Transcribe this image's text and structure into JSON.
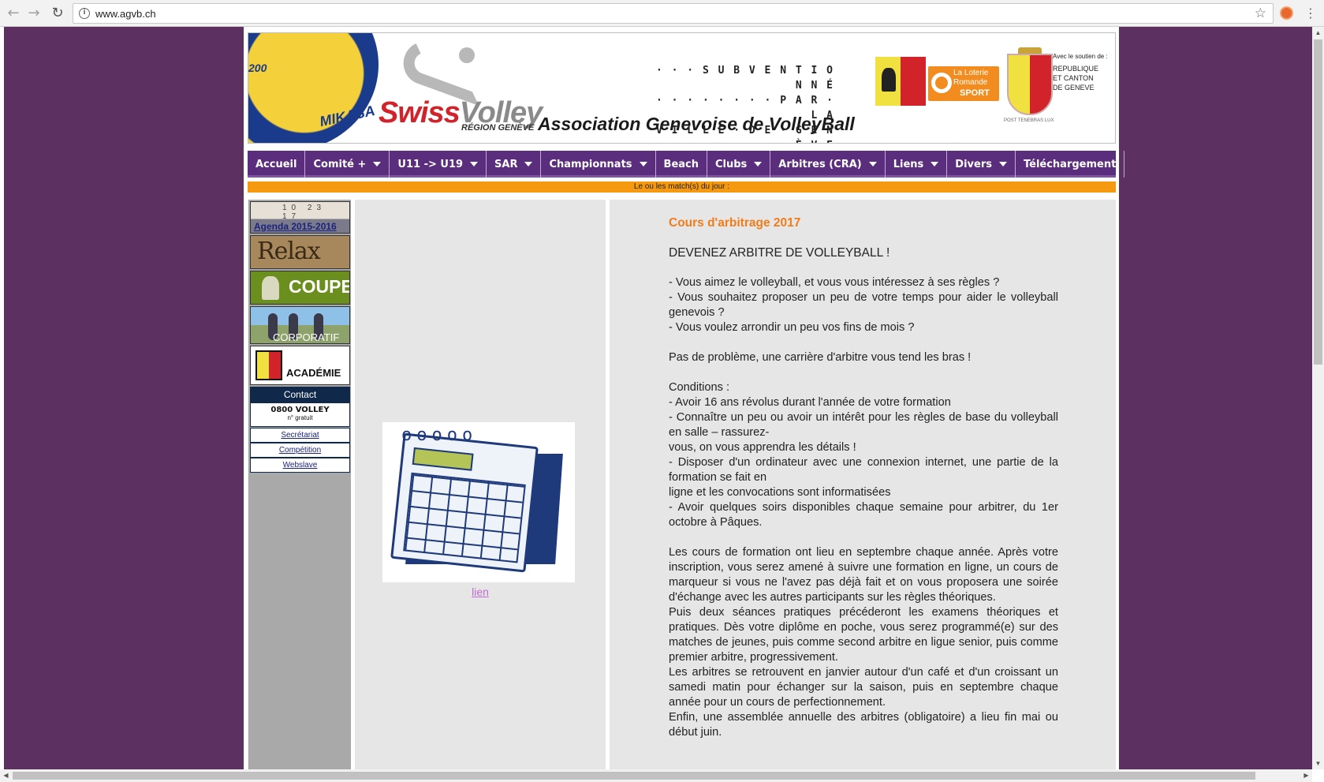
{
  "browser": {
    "back_icon": "←",
    "forward_icon": "→",
    "reload_icon": "↻",
    "info_icon": "i",
    "url": "www.agvb.ch",
    "star_icon": "☆",
    "menu_icon": "⋮"
  },
  "header": {
    "ball_brand": "MIKASA",
    "ball_number": "200",
    "logo_swiss": "Swiss",
    "logo_volley": "Volley",
    "logo_region": "RÉGION GENÈVE",
    "title": "Association Genevoise de VolleyBall",
    "subvention_lines": [
      "· · · S U B V E N T I O N N É",
      "· · · · · · · · P A R · L A",
      "V I L L E · D E · G E N È V E"
    ],
    "loro_text": "La Loterie Romande",
    "loro_sport": "SPORT",
    "shield_motto": "POST TENEBRAS LUX",
    "soutien_label": "Avec le soutien de :",
    "soutien_lines": [
      "REPUBLIQUE",
      "ET CANTON",
      "DE GENEVE"
    ]
  },
  "nav": {
    "items": [
      {
        "label": "Accueil",
        "dropdown": false
      },
      {
        "label": "Comité +",
        "dropdown": true
      },
      {
        "label": "U11 -> U19",
        "dropdown": true
      },
      {
        "label": "SAR",
        "dropdown": true
      },
      {
        "label": "Championnats",
        "dropdown": true
      },
      {
        "label": "Beach",
        "dropdown": false
      },
      {
        "label": "Clubs",
        "dropdown": true
      },
      {
        "label": "Arbitres (CRA)",
        "dropdown": true
      },
      {
        "label": "Liens",
        "dropdown": true
      },
      {
        "label": "Divers",
        "dropdown": true
      },
      {
        "label": "Téléchargement",
        "dropdown": false
      }
    ]
  },
  "match_bar": "Le ou les match(s) du jour :",
  "sidebar": {
    "agenda": "Agenda 2015-2016",
    "agenda_dates": "10 23 17",
    "relax": "Relax",
    "coupe": "COUPE",
    "corporatif": "CORPORATIF",
    "academie": "ACADÉMIE",
    "contact_header": "Contact",
    "phone": "0800 VOLLEY",
    "phone_note": "n° gratuit",
    "links": [
      "Secrétariat",
      "Compétition",
      "Webslave"
    ]
  },
  "middle": {
    "calendar_rings": "ooooo",
    "link_label": "lien"
  },
  "main": {
    "title": "Cours d'arbitrage 2017",
    "heading": "DEVENEZ ARBITRE DE VOLLEYBALL !",
    "para1": [
      "- Vous aimez le volleyball, et vous vous intéressez à ses règles ?",
      "- Vous souhaitez proposer un peu de votre temps pour aider le volleyball genevois ?",
      "- Vous voulez arrondir un peu vos fins de mois ?"
    ],
    "para2": "Pas de problème, une carrière d'arbitre vous tend les bras !",
    "conditions_label": "Conditions :",
    "conditions": [
      "- Avoir 16 ans révolus durant l'année de votre formation",
      "- Connaître un peu ou avoir un intérêt pour les règles de base du volleyball en salle – rassurez-",
      "vous, on vous apprendra les détails !",
      "- Disposer d'un ordinateur avec une connexion internet, une partie de la formation se fait en",
      "ligne et les convocations sont informatisées",
      "- Avoir quelques soirs disponibles chaque semaine pour arbitrer, du 1er octobre à Pâques."
    ],
    "formation": [
      "Les cours de formation ont lieu en septembre chaque année. Après votre inscription, vous serez amené à suivre une formation en ligne, un cours de marqueur si vous ne l'avez pas déjà fait et on vous proposera une soirée d'échange avec les autres participants sur les règles théoriques.",
      "Puis deux séances pratiques précéderont les examens théoriques et pratiques. Dès votre diplôme en poche, vous serez programmé(e) sur des matches de jeunes, puis comme second arbitre en ligue senior, puis comme premier arbitre, progressivement.",
      "Les arbitres se retrouvent en janvier autour d'un café et d'un croissant un samedi matin pour échanger sur la saison, puis en septembre chaque année pour un cours de perfectionnement.",
      "Enfin, une assemblée annuelle des arbitres (obligatoire) a lieu fin mai ou début juin."
    ]
  },
  "scrollbar": {
    "up": "▲",
    "down": "▼",
    "left": "◀",
    "right": "▶"
  }
}
